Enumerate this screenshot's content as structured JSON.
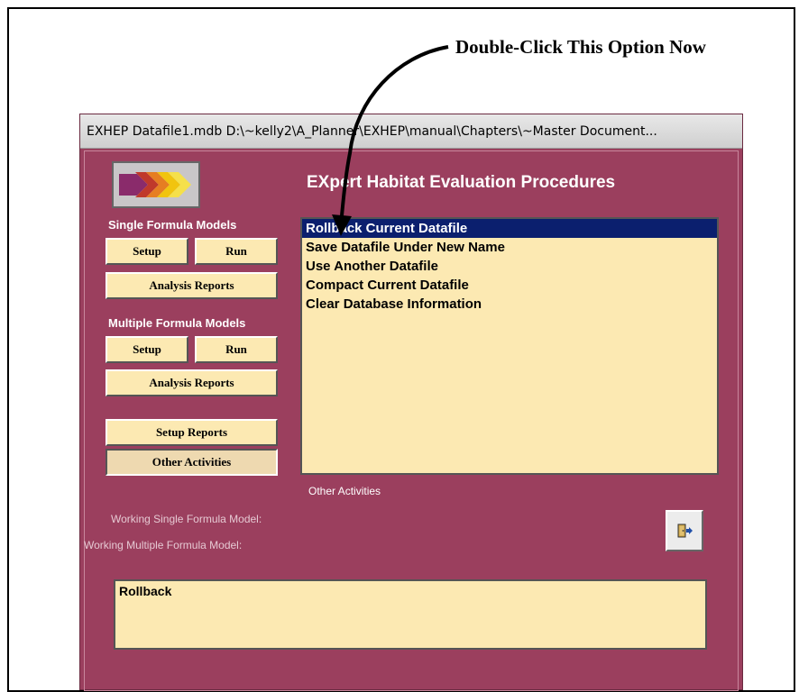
{
  "callout": {
    "text": "Double-Click This Option Now"
  },
  "window": {
    "title": "EXHEP    Datafile1.mdb    D:\\~kelly2\\A_Planner\\EXHEP\\manual\\Chapters\\~Master Document..."
  },
  "app_title": "EXpert Habitat Evaluation Procedures",
  "single_formula": {
    "label": "Single Formula Models",
    "setup_label": "Setup",
    "run_label": "Run",
    "reports_label": "Analysis Reports"
  },
  "multiple_formula": {
    "label": "Multiple Formula Models",
    "setup_label": "Setup",
    "run_label": "Run",
    "reports_label": "Analysis Reports"
  },
  "setup_reports_label": "Setup Reports",
  "other_activities_label": "Other Activities",
  "options_list": {
    "items": [
      {
        "label": "Rollback Current Datafile",
        "selected": true
      },
      {
        "label": "Save Datafile Under New Name",
        "selected": false
      },
      {
        "label": "Use Another Datafile",
        "selected": false
      },
      {
        "label": "Compact Current Datafile",
        "selected": false
      },
      {
        "label": "Clear Database Information",
        "selected": false
      }
    ],
    "caption": "Other Activities"
  },
  "working_single_label": "Working Single Formula Model:",
  "working_multiple_label": "Working Multiple Formula Model:",
  "status_text": "Rollback",
  "icons": {
    "exit": "exit-door-icon",
    "logo": "chevron-arrows-logo-icon"
  },
  "colors": {
    "window_bg": "#9b3f5e",
    "panel_bg": "#fce9b2",
    "selection": "#0b1f6e"
  }
}
